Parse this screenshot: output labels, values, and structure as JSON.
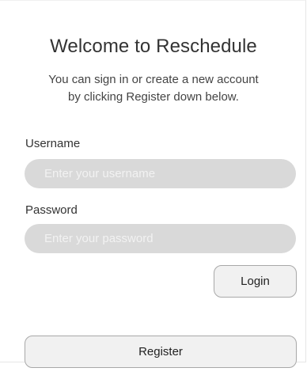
{
  "login": {
    "title": "Welcome to Reschedule",
    "subtitle_line1": "You can sign in or create a new account",
    "subtitle_line2": "by clicking Register down below.",
    "username_label": "Username",
    "username_placeholder": "Enter your username",
    "username_value": "",
    "password_label": "Password",
    "password_placeholder": "Enter your password",
    "password_value": "",
    "login_button": "Login",
    "register_button": "Register"
  }
}
